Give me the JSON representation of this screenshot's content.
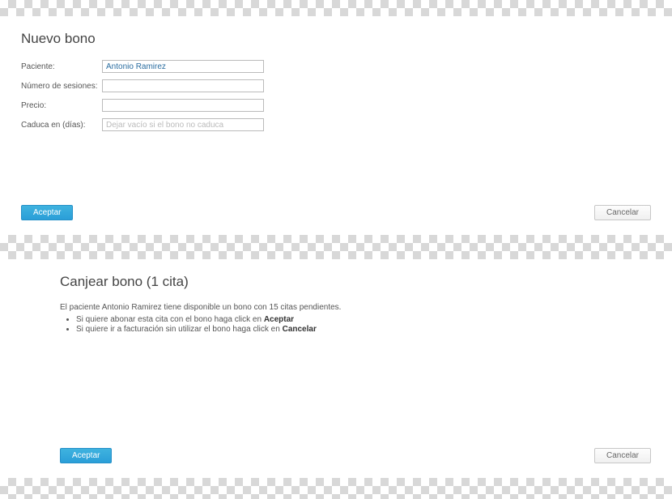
{
  "top": {
    "title": "Nuevo bono",
    "fields": {
      "paciente_label": "Paciente:",
      "paciente_value": "Antonio Ramirez",
      "sesiones_label": "Número de sesiones:",
      "sesiones_value": "",
      "precio_label": "Precio:",
      "precio_value": "",
      "caduca_label": "Caduca en (días):",
      "caduca_value": "",
      "caduca_placeholder": "Dejar vacío si el bono no caduca"
    },
    "buttons": {
      "accept": "Aceptar",
      "cancel": "Cancelar"
    }
  },
  "bottom": {
    "title": "Canjear bono (1 cita)",
    "intro": "El paciente Antonio Ramirez tiene disponible un bono con 15 citas pendientes.",
    "bullets": [
      {
        "pre": "Si quiere abonar esta cita con el bono haga click en ",
        "bold": "Aceptar"
      },
      {
        "pre": "Si quiere ir a facturación sin utilizar el bono haga click en ",
        "bold": "Cancelar"
      }
    ],
    "buttons": {
      "accept": "Aceptar",
      "cancel": "Cancelar"
    }
  }
}
